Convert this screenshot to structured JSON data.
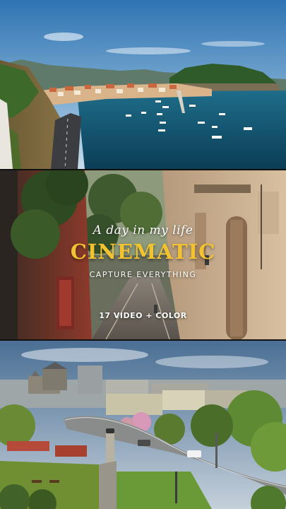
{
  "overlay": {
    "subtitle": "A day in my life",
    "title": "CINEMATIC",
    "tagline": "CAPTURE EVERYTHING",
    "badge": "17 VIDEO + COLOR"
  },
  "colors": {
    "title": "#f2c230",
    "text": "#ffffff",
    "sea": "#0f4a63",
    "sky": "#4f86b8"
  }
}
